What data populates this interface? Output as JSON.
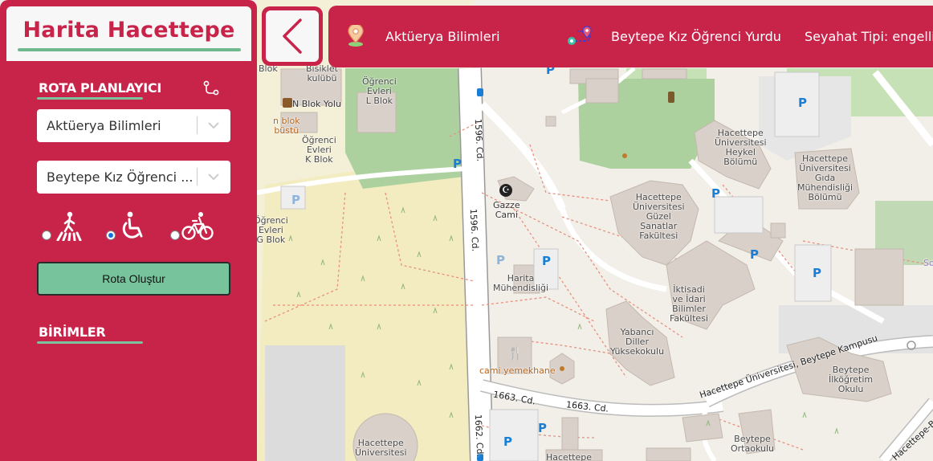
{
  "app": {
    "title": "Harita Hacettepe"
  },
  "route_planner": {
    "title": "ROTA PLANLAYICI",
    "route_icon": "route-pin-icon",
    "origin_value": "Aktüerya Bilimleri",
    "destination_value": "Beytepe Kız Öğrenci ...",
    "travel_modes": [
      {
        "name": "walking",
        "icon": "pedestrian-crossing-icon",
        "selected": false
      },
      {
        "name": "disabled",
        "icon": "wheelchair-icon",
        "selected": true
      },
      {
        "name": "bicycle",
        "icon": "bicycle-icon",
        "selected": false
      }
    ],
    "create_route_label": "Rota Oluştur"
  },
  "units": {
    "title": "BİRİMLER"
  },
  "topbar": {
    "origin": "Aktüerya Bilimleri",
    "destination": "Beytepe Kız Öğrenci Yurdu",
    "travel_type": "Seyahat Tipi: engelli"
  },
  "colors": {
    "brand": "#c8244a",
    "accent_green": "#77c49c",
    "panel_light": "#f7f7f7",
    "map_background": "#f2efe9",
    "map_green": "#add19e",
    "building": "#d9d0c9",
    "parking_blue": "#1a7fd4"
  },
  "map": {
    "labels": {
      "blok": "Blok",
      "bisiklet": "Bisiklet\nkulübü",
      "l_blok": "Öğrenci\nEvleri\nL Blok",
      "n_blok_yolu": "N Blok Yolu",
      "n_blok_bustu": "n blok\nbüstü",
      "k_blok": "Öğrenci\nEvleri\nK Blok",
      "g_blok": "Öğrenci\nEvleri\nG Blok",
      "gazze": "Gazze\nCami",
      "heykel": "Hacettepe\nÜniversitesi\nHeykel\nBölümü",
      "gida": "Hacettepe\nÜniversitesi\nGıda\nMühendisliği\nBölümü",
      "guzel_sanatlar": "Hacettepe\nÜniversitesi\nGüzel\nSanatlar\nFakültesi",
      "harita": "Harita\nMühendisliği",
      "iktisadi": "İktisadi\nve İdari\nBilimler\nFakültesi",
      "yabanci": "Yabancı\nDiller\nYüksekokulu",
      "cami_yemekhane": "cami yemekhane",
      "ilkogretim": "Beytepe\nİlköğretim\nOkulu",
      "ortaokul": "Beytepe\nOrtaokulu",
      "hu_bottom": "Hacettepe\nÜniversitesi",
      "hacettepe_bottom": "Hacettepe",
      "so": "So"
    },
    "roads": {
      "road_1596_a": "1596. Cd.",
      "road_1596_b": "1596. Cd.",
      "road_1662": "1662. Cd.",
      "road_1663_a": "1663. Cd.",
      "road_1663_b": "1663. Cd.",
      "campus_road": "Hacettepe Üniversitesi, Beytepe Kampusu",
      "beytepe_road": "Hacettepe-Beyt"
    },
    "parking_symbol": "P"
  }
}
